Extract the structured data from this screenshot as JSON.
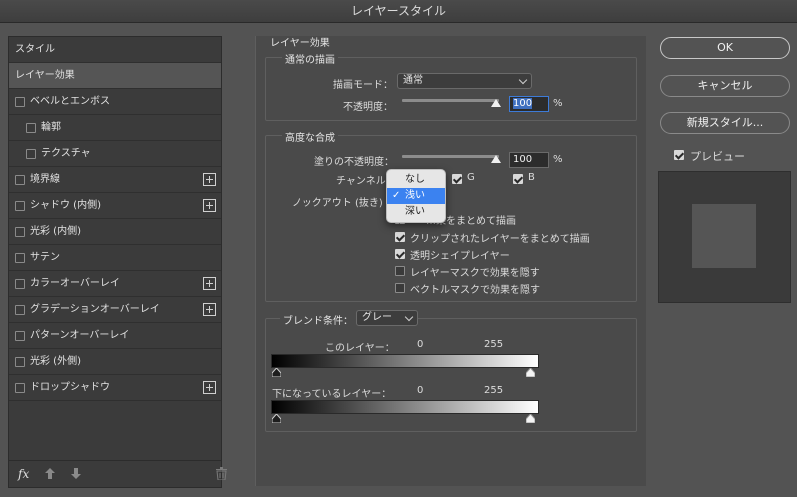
{
  "window": {
    "title": "レイヤースタイル"
  },
  "styles_panel": {
    "header": "スタイル",
    "items": [
      {
        "label": "レイヤー効果",
        "selected": true,
        "checkbox": false,
        "plus": false
      },
      {
        "label": "ベベルとエンボス",
        "checkbox": true,
        "checked": false,
        "plus": false
      },
      {
        "label": "輪郭",
        "checkbox": true,
        "checked": false,
        "indent": true,
        "plus": false
      },
      {
        "label": "テクスチャ",
        "checkbox": true,
        "checked": false,
        "indent": true,
        "plus": false
      },
      {
        "label": "境界線",
        "checkbox": true,
        "checked": false,
        "plus": true
      },
      {
        "label": "シャドウ (内側)",
        "checkbox": true,
        "checked": false,
        "plus": true
      },
      {
        "label": "光彩 (内側)",
        "checkbox": true,
        "checked": false,
        "plus": false
      },
      {
        "label": "サテン",
        "checkbox": true,
        "checked": false,
        "plus": false
      },
      {
        "label": "カラーオーバーレイ",
        "checkbox": true,
        "checked": false,
        "plus": true
      },
      {
        "label": "グラデーションオーバーレイ",
        "checkbox": true,
        "checked": false,
        "plus": true
      },
      {
        "label": "パターンオーバーレイ",
        "checkbox": true,
        "checked": false,
        "plus": false
      },
      {
        "label": "光彩 (外側)",
        "checkbox": true,
        "checked": false,
        "plus": false
      },
      {
        "label": "ドロップシャドウ",
        "checkbox": true,
        "checked": false,
        "plus": true
      }
    ],
    "footer": {
      "fx_label": "fx",
      "icons": [
        "arrow-up-icon",
        "arrow-down-icon",
        "trash-icon"
      ]
    }
  },
  "effects": {
    "section_title": "レイヤー効果",
    "normal": {
      "title": "通常の描画",
      "blend_mode_label": "描画モード：",
      "blend_mode_value": "通常",
      "opacity_label": "不透明度：",
      "opacity_value": "100",
      "opacity_fraction": 1.0,
      "unit": "%"
    },
    "advanced": {
      "title": "高度な合成",
      "fill_opacity_label": "塗りの不透明度：",
      "fill_opacity_value": "100",
      "fill_opacity_fraction": 1.0,
      "unit": "%",
      "channels_label": "チャンネル",
      "channel_g": "G",
      "channel_b": "B",
      "knockout_label": "ノックアウト (抜き)",
      "knockout_options": [
        "なし",
        "浅い",
        "深い"
      ],
      "knockout_selected": "浅い",
      "options": [
        {
          "label": "…果をまとめて描画",
          "checked": true
        },
        {
          "label": "クリップされたレイヤーをまとめて描画",
          "checked": true
        },
        {
          "label": "透明シェイプレイヤー",
          "checked": true
        },
        {
          "label": "レイヤーマスクで効果を隠す",
          "checked": false
        },
        {
          "label": "ベクトルマスクで効果を隠す",
          "checked": false
        }
      ]
    },
    "blend_if": {
      "title": "ブレンド条件：",
      "channel_value": "グレー",
      "this_layer": {
        "label": "このレイヤー：",
        "low": "0",
        "high": "255"
      },
      "underlying_layer": {
        "label": "下になっているレイヤー：",
        "low": "0",
        "high": "255"
      }
    }
  },
  "buttons": {
    "ok": "OK",
    "cancel": "キャンセル",
    "new_style": "新規スタイル...",
    "preview_label": "プレビュー",
    "preview_checked": true
  },
  "colors": {
    "dialog_bg": "#535353",
    "panel_bg": "#3b3b3b",
    "selection": "#3b82f0"
  }
}
